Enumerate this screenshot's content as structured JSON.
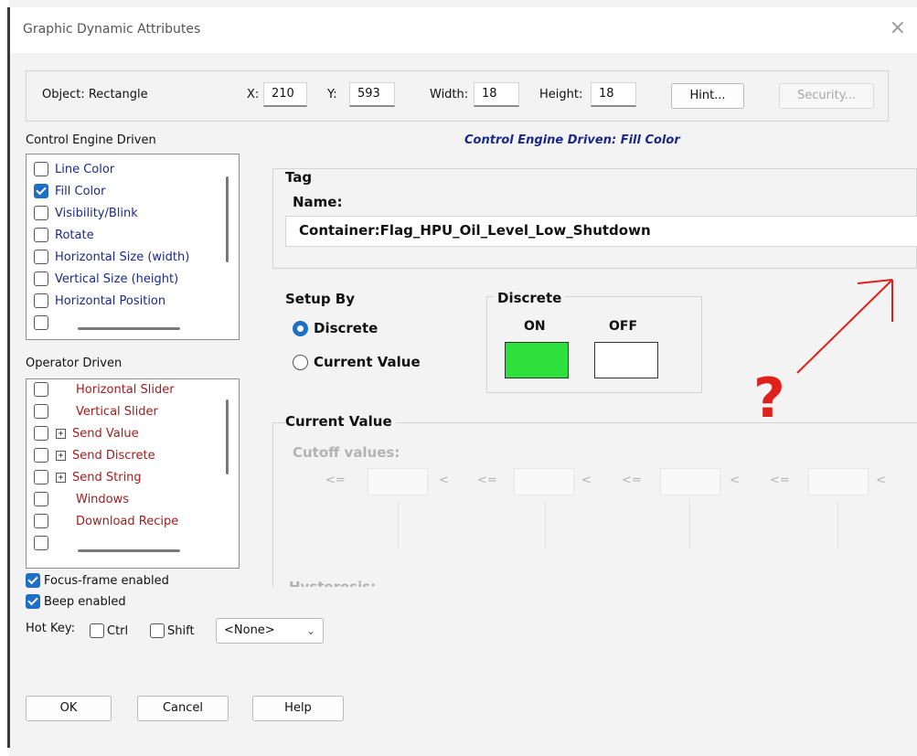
{
  "window": {
    "title": "Graphic Dynamic Attributes",
    "close_glyph": "×"
  },
  "object_bar": {
    "object_label": "Object: Rectangle",
    "x_label": "X:",
    "x_value": "210",
    "y_label": "Y:",
    "y_value": "593",
    "width_label": "Width:",
    "width_value": "18",
    "height_label": "Height:",
    "height_value": "18",
    "hint_button": "Hint...",
    "security_button": "Security..."
  },
  "control_engine": {
    "section_label": "Control Engine Driven",
    "items": [
      {
        "label": "Line Color",
        "checked": false
      },
      {
        "label": "Fill Color",
        "checked": true
      },
      {
        "label": "Visibility/Blink",
        "checked": false
      },
      {
        "label": "Rotate",
        "checked": false
      },
      {
        "label": "Horizontal Size (width)",
        "checked": false
      },
      {
        "label": "Vertical Size (height)",
        "checked": false
      },
      {
        "label": "Horizontal Position",
        "checked": false
      }
    ]
  },
  "operator_driven": {
    "section_label": "Operator Driven",
    "items": [
      {
        "label": "Horizontal Slider",
        "expandable": false,
        "checked": false
      },
      {
        "label": "Vertical Slider",
        "expandable": false,
        "checked": false
      },
      {
        "label": "Send Value",
        "expandable": true,
        "checked": false
      },
      {
        "label": "Send Discrete",
        "expandable": true,
        "checked": false
      },
      {
        "label": "Send String",
        "expandable": true,
        "checked": false
      },
      {
        "label": "Windows",
        "expandable": false,
        "checked": false
      },
      {
        "label": "Download Recipe",
        "expandable": false,
        "checked": false
      }
    ]
  },
  "options": {
    "focus_frame_label": "Focus-frame enabled",
    "focus_frame_checked": true,
    "beep_label": "Beep enabled",
    "beep_checked": true,
    "hotkey_label": "Hot Key:",
    "ctrl_label": "Ctrl",
    "shift_label": "Shift",
    "hotkey_value": "<None>"
  },
  "panel": {
    "title": "Control Engine Driven: Fill Color",
    "tag_heading": "Tag",
    "name_label": "Name:",
    "tag_name": "Container:Flag_HPU_Oil_Level_Low_Shutdown",
    "setup_heading": "Setup By",
    "setup_options": [
      "Discrete",
      "Current Value"
    ],
    "setup_selected": "Discrete",
    "discrete_heading": "Discrete",
    "on_label": "ON",
    "off_label": "OFF",
    "on_color": "#2ee03a",
    "off_color": "#ffffff",
    "current_value_heading": "Current Value",
    "cutoff_label": "Cutoff values:",
    "cutoff_ops": [
      "<=",
      "<",
      "<=",
      "<",
      "<=",
      "<",
      "<=",
      "<"
    ],
    "hysteresis_label": "Hysteresis:"
  },
  "annotation": {
    "question_mark": "?",
    "color": "#e0201a"
  },
  "footer": {
    "ok": "OK",
    "cancel": "Cancel",
    "help": "Help"
  }
}
